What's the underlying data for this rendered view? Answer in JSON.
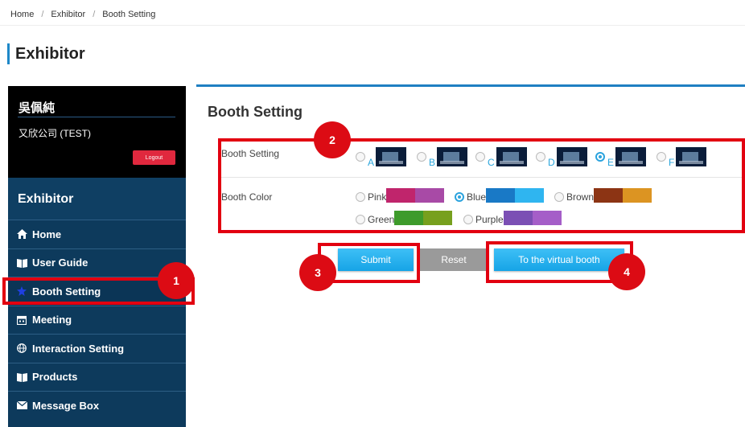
{
  "breadcrumb": {
    "home": "Home",
    "exhibitor": "Exhibitor",
    "current": "Booth Setting"
  },
  "page_title": "Exhibitor",
  "sidebar": {
    "user_name": "吳佩純",
    "company": "又欣公司 (TEST)",
    "logout_label": "Logout",
    "heading": "Exhibitor",
    "items": [
      {
        "label": "Home",
        "icon": "home-icon"
      },
      {
        "label": "User Guide",
        "icon": "book-icon"
      },
      {
        "label": "Booth Setting",
        "icon": "star-icon"
      },
      {
        "label": "Meeting",
        "icon": "calendar-icon"
      },
      {
        "label": "Interaction Setting",
        "icon": "globe-icon"
      },
      {
        "label": "Products",
        "icon": "book-icon"
      },
      {
        "label": "Message Box",
        "icon": "envelope-icon"
      }
    ]
  },
  "main": {
    "title": "Booth Setting",
    "booth_setting_label": "Booth Setting",
    "booth_color_label": "Booth Color",
    "booth_options": [
      {
        "letter": "A",
        "selected": false
      },
      {
        "letter": "B",
        "selected": false
      },
      {
        "letter": "C",
        "selected": false
      },
      {
        "letter": "D",
        "selected": false
      },
      {
        "letter": "E",
        "selected": true
      },
      {
        "letter": "F",
        "selected": false
      }
    ],
    "color_options": [
      {
        "name": "Pink",
        "selected": false,
        "colors": [
          "#c0256c",
          "#a84aa6"
        ]
      },
      {
        "name": "Blue",
        "selected": true,
        "colors": [
          "#1979c6",
          "#2fb5f0"
        ]
      },
      {
        "name": "Brown",
        "selected": false,
        "colors": [
          "#8c3414",
          "#dc9422"
        ]
      },
      {
        "name": "Green",
        "selected": false,
        "colors": [
          "#3e9b2b",
          "#77a01e"
        ]
      },
      {
        "name": "Purple",
        "selected": false,
        "colors": [
          "#7b4fb4",
          "#a55ec8"
        ]
      }
    ],
    "submit_label": "Submit",
    "reset_label": "Reset",
    "virtual_booth_label": "To the virtual booth"
  },
  "annotations": [
    "1",
    "2",
    "3",
    "4"
  ],
  "colors": {
    "accent": "#1e88c8",
    "annotation_red": "#e20010",
    "sidebar_bg": "#0d3a5c"
  }
}
